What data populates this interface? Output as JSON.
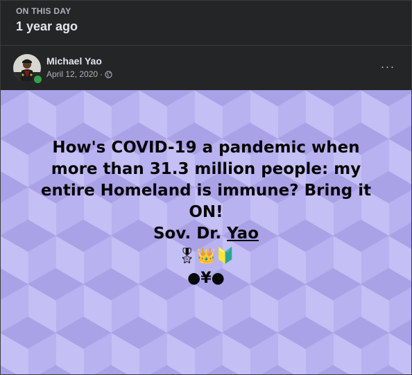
{
  "memory": {
    "kicker": "ON THIS DAY",
    "heading": "1 year ago"
  },
  "post": {
    "author": "Michael Yao",
    "date": "April 12, 2020",
    "separator": " · ",
    "privacy_icon": "globe-icon",
    "more_label": "···",
    "text_line_1": "How's COVID-19 a pandemic when",
    "text_line_2": "more than 31.3 million people: my",
    "text_line_3": "entire Homeland is immune? Bring it",
    "text_line_4": "ON!",
    "sig_prefix": "Sov. Dr. ",
    "sig_name": "Yao",
    "emojis": "🎖👑🔰",
    "symbols": "●¥●",
    "background_color": "#b8b2f0",
    "online_color": "#31a24c"
  }
}
